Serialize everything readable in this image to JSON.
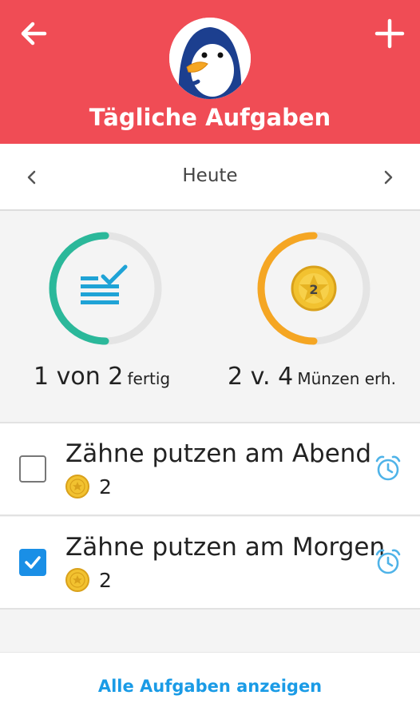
{
  "header": {
    "title": "Tägliche Aufgaben",
    "color": "#f04c55"
  },
  "datebar": {
    "label": "Heute"
  },
  "stats": {
    "tasks": {
      "done": 1,
      "total": 2,
      "count_text": "1 von 2",
      "suffix": "fertig",
      "color": "#2bb89a"
    },
    "coins": {
      "earned": 2,
      "total": 4,
      "count_text": "2 v. 4",
      "suffix": "Münzen erh.",
      "color": "#f5a623",
      "coin_label": "2"
    }
  },
  "tasks": [
    {
      "name": "Zähne putzen am Abend",
      "coins": "2",
      "checked": false
    },
    {
      "name": "Zähne putzen am Morgen",
      "coins": "2",
      "checked": true
    }
  ],
  "footer": {
    "link": "Alle Aufgaben anzeigen"
  },
  "colors": {
    "accent_blue": "#1a8fe6",
    "coin_gold": "#f2c230"
  },
  "icons": [
    "back-arrow-icon",
    "plus-icon",
    "penguin-avatar",
    "chevron-left-icon",
    "chevron-right-icon",
    "task-list-icon",
    "coin-icon",
    "alarm-clock-icon",
    "checkmark-icon"
  ]
}
